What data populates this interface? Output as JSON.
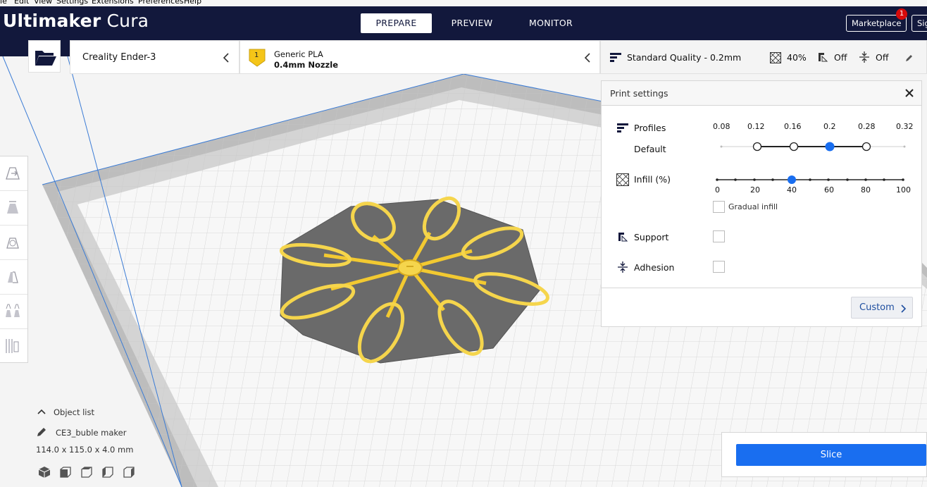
{
  "menu": {
    "items": [
      "ile",
      "Edit",
      "View",
      "Settings",
      "Extensions",
      "Preferences",
      "Help"
    ]
  },
  "header": {
    "logo_bold": "Ultimaker",
    "logo_light": " Cura",
    "tabs": [
      {
        "label": "PREPARE",
        "active": true
      },
      {
        "label": "PREVIEW",
        "active": false
      },
      {
        "label": "MONITOR",
        "active": false
      }
    ],
    "marketplace_label": "Marketplace",
    "marketplace_badge": "1",
    "signin_label": "Sig"
  },
  "printer": {
    "name": "Creality Ender-3"
  },
  "material": {
    "slot": "1",
    "name": "Generic PLA",
    "nozzle": "0.4mm Nozzle"
  },
  "settings_bar": {
    "quality": "Standard Quality - 0.2mm",
    "infill": "40%",
    "support": "Off",
    "adhesion": "Off"
  },
  "print_settings": {
    "title": "Print settings",
    "profiles_label": "Profiles",
    "profile_default": "Default",
    "layer_heights": [
      "0.08",
      "0.12",
      "0.16",
      "0.2",
      "0.28",
      "0.32"
    ],
    "selected_layer_height": "0.2",
    "infill_label": "Infill (%)",
    "infill_ticks": [
      "0",
      "20",
      "40",
      "60",
      "80",
      "100"
    ],
    "infill_value": 40,
    "gradual_infill_label": "Gradual infill",
    "support_label": "Support",
    "adhesion_label": "Adhesion",
    "custom_label": "Custom"
  },
  "object_list": {
    "toggle_label": "Object list",
    "object_name": "CE3_buble maker",
    "dimensions": "114.0 x 115.0 x 4.0 mm"
  },
  "slice": {
    "button_label": "Slice"
  },
  "colors": {
    "header_bg": "#12183c",
    "accent_blue": "#196ef0",
    "model_yellow": "#f7d34a",
    "raft_gray": "#6a6a6a"
  }
}
